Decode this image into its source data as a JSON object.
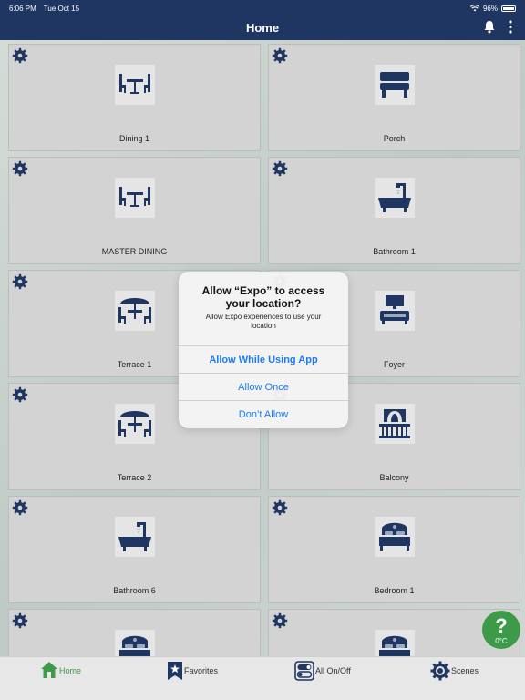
{
  "status_bar": {
    "time": "6:06 PM",
    "date": "Tue Oct 15",
    "battery": "96%",
    "battery_level": 0.96
  },
  "header": {
    "title": "Home"
  },
  "rooms": [
    {
      "label": "Dining 1",
      "icon": "dining-table-icon"
    },
    {
      "label": "Porch",
      "icon": "bench-icon"
    },
    {
      "label": "MASTER DINING",
      "icon": "dining-table-icon"
    },
    {
      "label": "Bathroom 1",
      "icon": "bathtub-icon"
    },
    {
      "label": "Terrace 1",
      "icon": "patio-umbrella-icon"
    },
    {
      "label": "Foyer",
      "icon": "tv-sofa-icon"
    },
    {
      "label": "Terrace 2",
      "icon": "patio-umbrella-icon"
    },
    {
      "label": "Balcony",
      "icon": "balcony-icon"
    },
    {
      "label": "Bathroom 6",
      "icon": "bathtub-icon"
    },
    {
      "label": "Bedroom 1",
      "icon": "bed-icon"
    },
    {
      "label": "",
      "icon": "bed-icon"
    },
    {
      "label": "",
      "icon": "bed-icon"
    }
  ],
  "dialog": {
    "title": "Allow “Expo” to access your location?",
    "message": "Allow Expo experiences to use your location",
    "buttons": [
      "Allow While Using App",
      "Allow Once",
      "Don’t Allow"
    ]
  },
  "help": {
    "symbol": "?",
    "temperature": "0°C"
  },
  "tabs": [
    {
      "label": "Home",
      "icon": "house-icon",
      "active": true
    },
    {
      "label": "Favorites",
      "icon": "star-bookmark-icon",
      "active": false
    },
    {
      "label": "All On/Off",
      "icon": "toggle-switch-icon",
      "active": false
    },
    {
      "label": "Scenes",
      "icon": "scenes-gear-icon",
      "active": false
    }
  ],
  "colors": {
    "navy": "#1f3562",
    "green": "#3d9a48",
    "link_blue": "#1e7cf2",
    "tile": "#d3d3d3"
  }
}
